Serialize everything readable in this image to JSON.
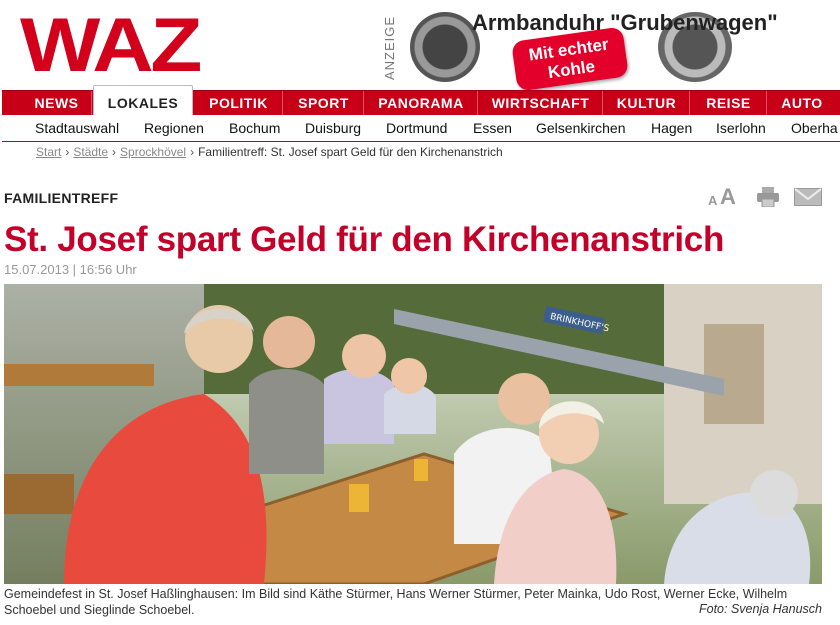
{
  "logo": "WAZ",
  "ad": {
    "label": "ANZEIGE",
    "title": "Armbanduhr \"Grubenwagen\"",
    "badge": "Mit echter Kohle"
  },
  "nav": {
    "items": [
      {
        "label": "NEWS"
      },
      {
        "label": "LOKALES"
      },
      {
        "label": "POLITIK"
      },
      {
        "label": "SPORT"
      },
      {
        "label": "PANORAMA"
      },
      {
        "label": "WIRTSCHAFT"
      },
      {
        "label": "KULTUR"
      },
      {
        "label": "REISE"
      },
      {
        "label": "AUTO"
      }
    ]
  },
  "subnav": {
    "items": [
      {
        "label": "Stadtauswahl"
      },
      {
        "label": "Regionen"
      },
      {
        "label": "Bochum"
      },
      {
        "label": "Duisburg"
      },
      {
        "label": "Dortmund"
      },
      {
        "label": "Essen"
      },
      {
        "label": "Gelsenkirchen"
      },
      {
        "label": "Hagen"
      },
      {
        "label": "Iserlohn"
      },
      {
        "label": "Oberha"
      }
    ]
  },
  "breadcrumb": {
    "items": [
      "Start",
      "Städte",
      "Sprockhövel"
    ],
    "current": "Familientreff: St. Josef spart Geld für den Kirchenanstrich",
    "separator": "›"
  },
  "article": {
    "kicker": "FAMILIENTREFF",
    "headline": "St. Josef spart Geld für den Kirchenanstrich",
    "date": "15.07.2013 | 16:56 Uhr",
    "caption": "Gemeindefest in St. Josef Haßlinghausen: Im Bild sind Käthe Stürmer, Hans Werner Stürmer, Peter Mainka, Udo Rost, Werner Ecke, Wilhelm Schoebel und Sieglinde Schoebel.",
    "credit": "Foto: Svenja Hanusch",
    "photo_sign": "BRINKHOFF'S"
  },
  "tools": {
    "font_small": "A",
    "font_large": "A",
    "print_icon": "printer-icon",
    "mail_icon": "mail-icon"
  },
  "colors": {
    "brand_red": "#d3001c",
    "nav_red": "#c70018",
    "headline_red": "#c3002a"
  }
}
